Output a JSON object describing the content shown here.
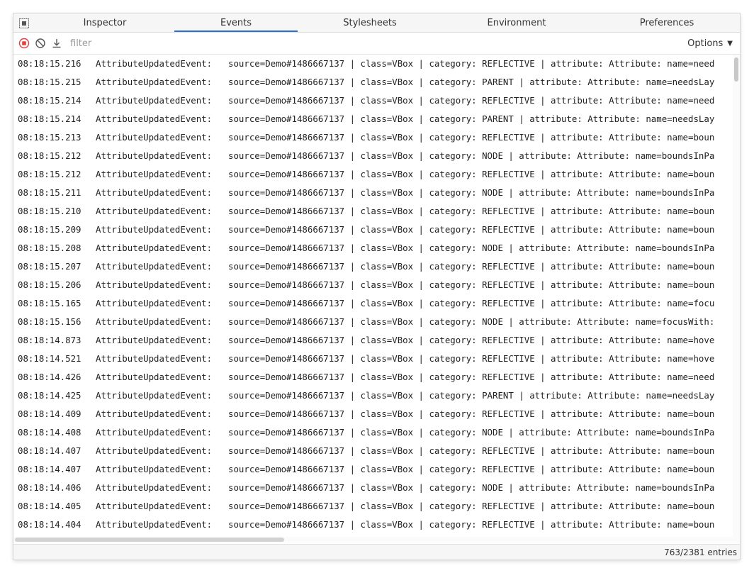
{
  "tabs": [
    {
      "label": "Inspector"
    },
    {
      "label": "Events"
    },
    {
      "label": "Stylesheets"
    },
    {
      "label": "Environment"
    },
    {
      "label": "Preferences"
    }
  ],
  "active_tab": "Events",
  "toolbar": {
    "icons": [
      "record-stop-icon",
      "clear-icon",
      "download-icon"
    ],
    "filter_placeholder": "filter",
    "filter_value": "",
    "options_label": "Options"
  },
  "events": [
    {
      "time": "08:18:15.216",
      "event": "AttributeUpdatedEvent:",
      "detail": "source=Demo#1486667137 | class=VBox | category: REFLECTIVE | attribute: Attribute: name=need"
    },
    {
      "time": "08:18:15.215",
      "event": "AttributeUpdatedEvent:",
      "detail": "source=Demo#1486667137 | class=VBox | category: PARENT | attribute: Attribute: name=needsLay"
    },
    {
      "time": "08:18:15.214",
      "event": "AttributeUpdatedEvent:",
      "detail": "source=Demo#1486667137 | class=VBox | category: REFLECTIVE | attribute: Attribute: name=need"
    },
    {
      "time": "08:18:15.214",
      "event": "AttributeUpdatedEvent:",
      "detail": "source=Demo#1486667137 | class=VBox | category: PARENT | attribute: Attribute: name=needsLay"
    },
    {
      "time": "08:18:15.213",
      "event": "AttributeUpdatedEvent:",
      "detail": "source=Demo#1486667137 | class=VBox | category: REFLECTIVE | attribute: Attribute: name=boun"
    },
    {
      "time": "08:18:15.212",
      "event": "AttributeUpdatedEvent:",
      "detail": "source=Demo#1486667137 | class=VBox | category: NODE | attribute: Attribute: name=boundsInPa"
    },
    {
      "time": "08:18:15.212",
      "event": "AttributeUpdatedEvent:",
      "detail": "source=Demo#1486667137 | class=VBox | category: REFLECTIVE | attribute: Attribute: name=boun"
    },
    {
      "time": "08:18:15.211",
      "event": "AttributeUpdatedEvent:",
      "detail": "source=Demo#1486667137 | class=VBox | category: NODE | attribute: Attribute: name=boundsInPa"
    },
    {
      "time": "08:18:15.210",
      "event": "AttributeUpdatedEvent:",
      "detail": "source=Demo#1486667137 | class=VBox | category: REFLECTIVE | attribute: Attribute: name=boun"
    },
    {
      "time": "08:18:15.209",
      "event": "AttributeUpdatedEvent:",
      "detail": "source=Demo#1486667137 | class=VBox | category: REFLECTIVE | attribute: Attribute: name=boun"
    },
    {
      "time": "08:18:15.208",
      "event": "AttributeUpdatedEvent:",
      "detail": "source=Demo#1486667137 | class=VBox | category: NODE | attribute: Attribute: name=boundsInPa"
    },
    {
      "time": "08:18:15.207",
      "event": "AttributeUpdatedEvent:",
      "detail": "source=Demo#1486667137 | class=VBox | category: REFLECTIVE | attribute: Attribute: name=boun"
    },
    {
      "time": "08:18:15.206",
      "event": "AttributeUpdatedEvent:",
      "detail": "source=Demo#1486667137 | class=VBox | category: REFLECTIVE | attribute: Attribute: name=boun"
    },
    {
      "time": "08:18:15.165",
      "event": "AttributeUpdatedEvent:",
      "detail": "source=Demo#1486667137 | class=VBox | category: REFLECTIVE | attribute: Attribute: name=focu"
    },
    {
      "time": "08:18:15.156",
      "event": "AttributeUpdatedEvent:",
      "detail": "source=Demo#1486667137 | class=VBox | category: NODE | attribute: Attribute: name=focusWith:"
    },
    {
      "time": "08:18:14.873",
      "event": "AttributeUpdatedEvent:",
      "detail": "source=Demo#1486667137 | class=VBox | category: REFLECTIVE | attribute: Attribute: name=hove"
    },
    {
      "time": "08:18:14.521",
      "event": "AttributeUpdatedEvent:",
      "detail": "source=Demo#1486667137 | class=VBox | category: REFLECTIVE | attribute: Attribute: name=hove"
    },
    {
      "time": "08:18:14.426",
      "event": "AttributeUpdatedEvent:",
      "detail": "source=Demo#1486667137 | class=VBox | category: REFLECTIVE | attribute: Attribute: name=need"
    },
    {
      "time": "08:18:14.425",
      "event": "AttributeUpdatedEvent:",
      "detail": "source=Demo#1486667137 | class=VBox | category: PARENT | attribute: Attribute: name=needsLay"
    },
    {
      "time": "08:18:14.409",
      "event": "AttributeUpdatedEvent:",
      "detail": "source=Demo#1486667137 | class=VBox | category: REFLECTIVE | attribute: Attribute: name=boun"
    },
    {
      "time": "08:18:14.408",
      "event": "AttributeUpdatedEvent:",
      "detail": "source=Demo#1486667137 | class=VBox | category: NODE | attribute: Attribute: name=boundsInPa"
    },
    {
      "time": "08:18:14.407",
      "event": "AttributeUpdatedEvent:",
      "detail": "source=Demo#1486667137 | class=VBox | category: REFLECTIVE | attribute: Attribute: name=boun"
    },
    {
      "time": "08:18:14.407",
      "event": "AttributeUpdatedEvent:",
      "detail": "source=Demo#1486667137 | class=VBox | category: REFLECTIVE | attribute: Attribute: name=boun"
    },
    {
      "time": "08:18:14.406",
      "event": "AttributeUpdatedEvent:",
      "detail": "source=Demo#1486667137 | class=VBox | category: NODE | attribute: Attribute: name=boundsInPa"
    },
    {
      "time": "08:18:14.405",
      "event": "AttributeUpdatedEvent:",
      "detail": "source=Demo#1486667137 | class=VBox | category: REFLECTIVE | attribute: Attribute: name=boun"
    },
    {
      "time": "08:18:14.404",
      "event": "AttributeUpdatedEvent:",
      "detail": "source=Demo#1486667137 | class=VBox | category: REFLECTIVE | attribute: Attribute: name=boun"
    }
  ],
  "status": {
    "entries": "763/2381 entries"
  },
  "colors": {
    "accent": "#2b6fcf",
    "record": "#e0413c"
  }
}
